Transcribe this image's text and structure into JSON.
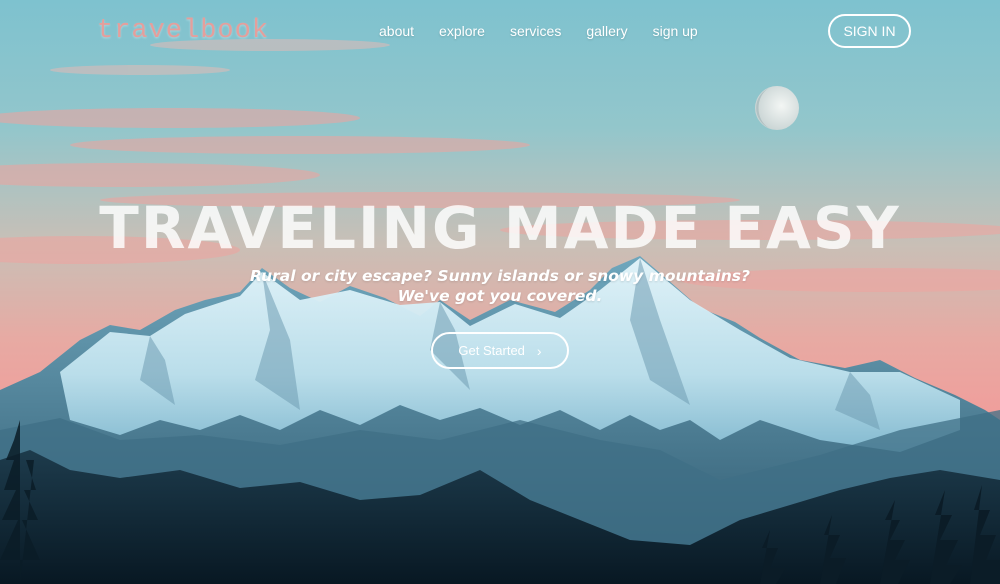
{
  "brand": {
    "logo_text": "travelbook"
  },
  "nav": {
    "links": [
      "about",
      "explore",
      "services",
      "gallery",
      "sign up"
    ],
    "signin_label": "SIGN IN"
  },
  "hero": {
    "headline": "TRAVELING MADE EASY",
    "subtitle_line1": "Rural or city escape? Sunny islands or snowy mountains?",
    "subtitle_line2": "We've got you covered.",
    "cta_label": "Get Started",
    "cta_icon": "chevron-right-icon"
  },
  "colors": {
    "sky_top": "#7fc3cf",
    "sky_mid": "#a7c9c4",
    "sky_pink": "#eaa7a0",
    "mountain_snow": "#dcf0f6",
    "mountain_shadow": "#5a93ab",
    "forest": "#0e2230",
    "logo": "#e49f9c"
  }
}
